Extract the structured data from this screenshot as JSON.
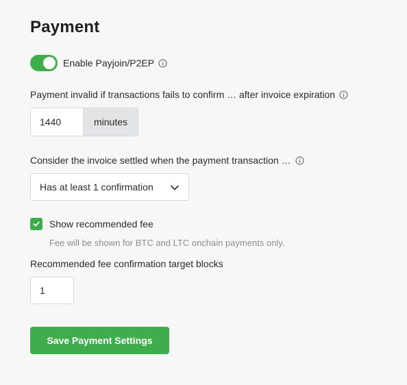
{
  "page": {
    "title": "Payment"
  },
  "payjoin": {
    "label": "Enable Payjoin/P2EP",
    "enabled": true,
    "info_icon": "info-circle-icon"
  },
  "expiration": {
    "label": "Payment invalid if transactions fails to confirm … after invoice expiration",
    "value": "1440",
    "suffix": "minutes",
    "info_icon": "info-circle-icon"
  },
  "settlement": {
    "label": "Consider the invoice settled when the payment transaction …",
    "selected": "Has at least 1 confirmation",
    "info_icon": "info-circle-icon"
  },
  "recommended_fee": {
    "label": "Show recommended fee",
    "checked": true,
    "help": "Fee will be shown for BTC and LTC onchain payments only."
  },
  "fee_target": {
    "label": "Recommended fee confirmation target blocks",
    "value": "1"
  },
  "actions": {
    "save_label": "Save Payment Settings"
  },
  "colors": {
    "accent": "#3fad4c",
    "background": "#f7f7f8",
    "muted_text": "#8b8d91"
  }
}
